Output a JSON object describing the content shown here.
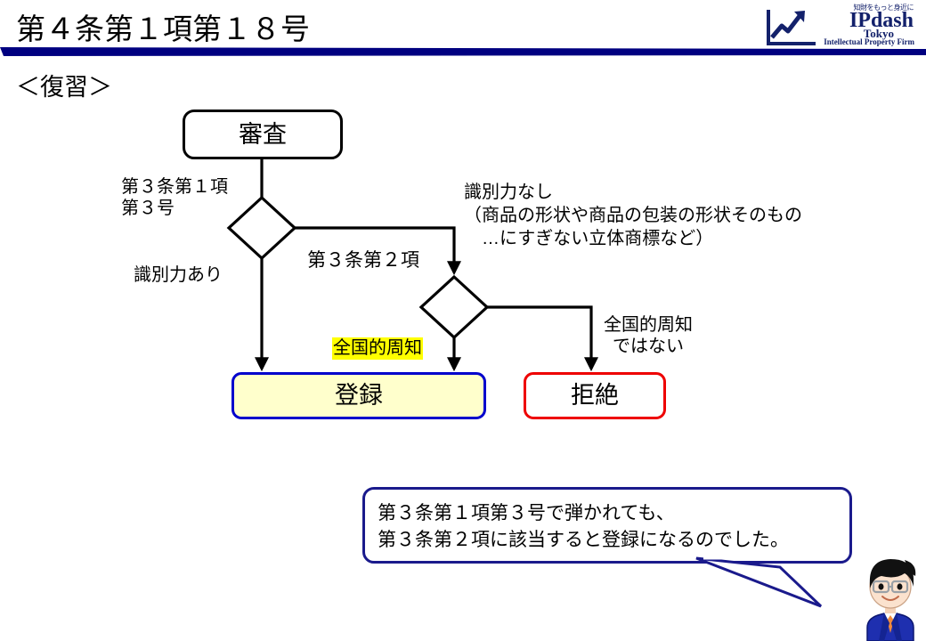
{
  "slide": {
    "title": "第４条第１項第１８号",
    "subtitle": "＜復習＞",
    "accent_navy": "#000080",
    "accent_blue": "#0000CC",
    "accent_red": "#EE0000",
    "highlight_yellow": "#FFFF00",
    "fill_cream": "#FFFFCC"
  },
  "logo": {
    "tagline": "知財をもっと身近に",
    "name": "IPdash",
    "city": "Tokyo",
    "firm": "Intellectual Property Firm",
    "mark": "chart-arrow-icon",
    "color": "#13216B"
  },
  "flowchart": {
    "nodes": {
      "examination": "審査",
      "registration": "登録",
      "rejection": "拒絶"
    },
    "labels": {
      "article3_1_3": "第３条第１項\n第３号",
      "distinctive_yes": "識別力あり",
      "article3_2": "第３条第２項",
      "no_distinctiveness": "識別力なし\n（商品の形状や商品の包装の形状そのもの\n　…にすぎない立体商標など）",
      "nationwide_known": "全国的周知",
      "not_nationwide": "全国的周知\nではない"
    }
  },
  "speech": {
    "text": "第３条第１項第３号で弾かれても、\n第３条第２項に該当すると登録になるのでした。"
  },
  "character": {
    "name": "presenter-avatar",
    "hair_color": "#111111",
    "skin_color": "#FBE2CE",
    "suit_color": "#1E2FAF",
    "tie_color": "#F08A3C"
  }
}
